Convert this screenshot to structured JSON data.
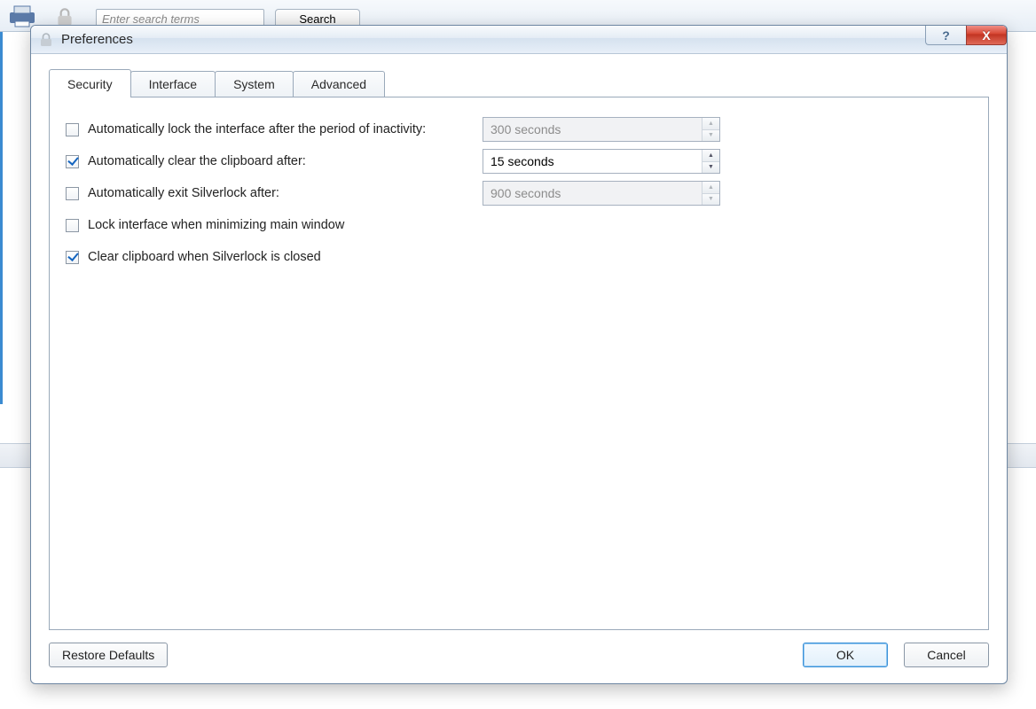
{
  "background": {
    "search_placeholder": "Enter search terms",
    "search_button": "Search"
  },
  "dialog": {
    "title": "Preferences",
    "help_glyph": "?",
    "close_glyph": "X"
  },
  "tabs": {
    "security": "Security",
    "interface": "Interface",
    "system": "System",
    "advanced": "Advanced",
    "active": "security"
  },
  "options": {
    "autolock": {
      "label": "Automatically lock the interface after the period of inactivity:",
      "checked": false,
      "value": "300 seconds",
      "enabled": false
    },
    "autoclear": {
      "label": "Automatically clear the clipboard after:",
      "checked": true,
      "value": "15 seconds",
      "enabled": true
    },
    "autoexit": {
      "label": "Automatically exit Silverlock after:",
      "checked": false,
      "value": "900 seconds",
      "enabled": false
    },
    "lockmin": {
      "label": "Lock interface when minimizing main window",
      "checked": false
    },
    "clearclose": {
      "label": "Clear clipboard when Silverlock is closed",
      "checked": true
    }
  },
  "buttons": {
    "restore": "Restore Defaults",
    "ok": "OK",
    "cancel": "Cancel"
  },
  "glyphs": {
    "up": "▲",
    "down": "▼"
  }
}
